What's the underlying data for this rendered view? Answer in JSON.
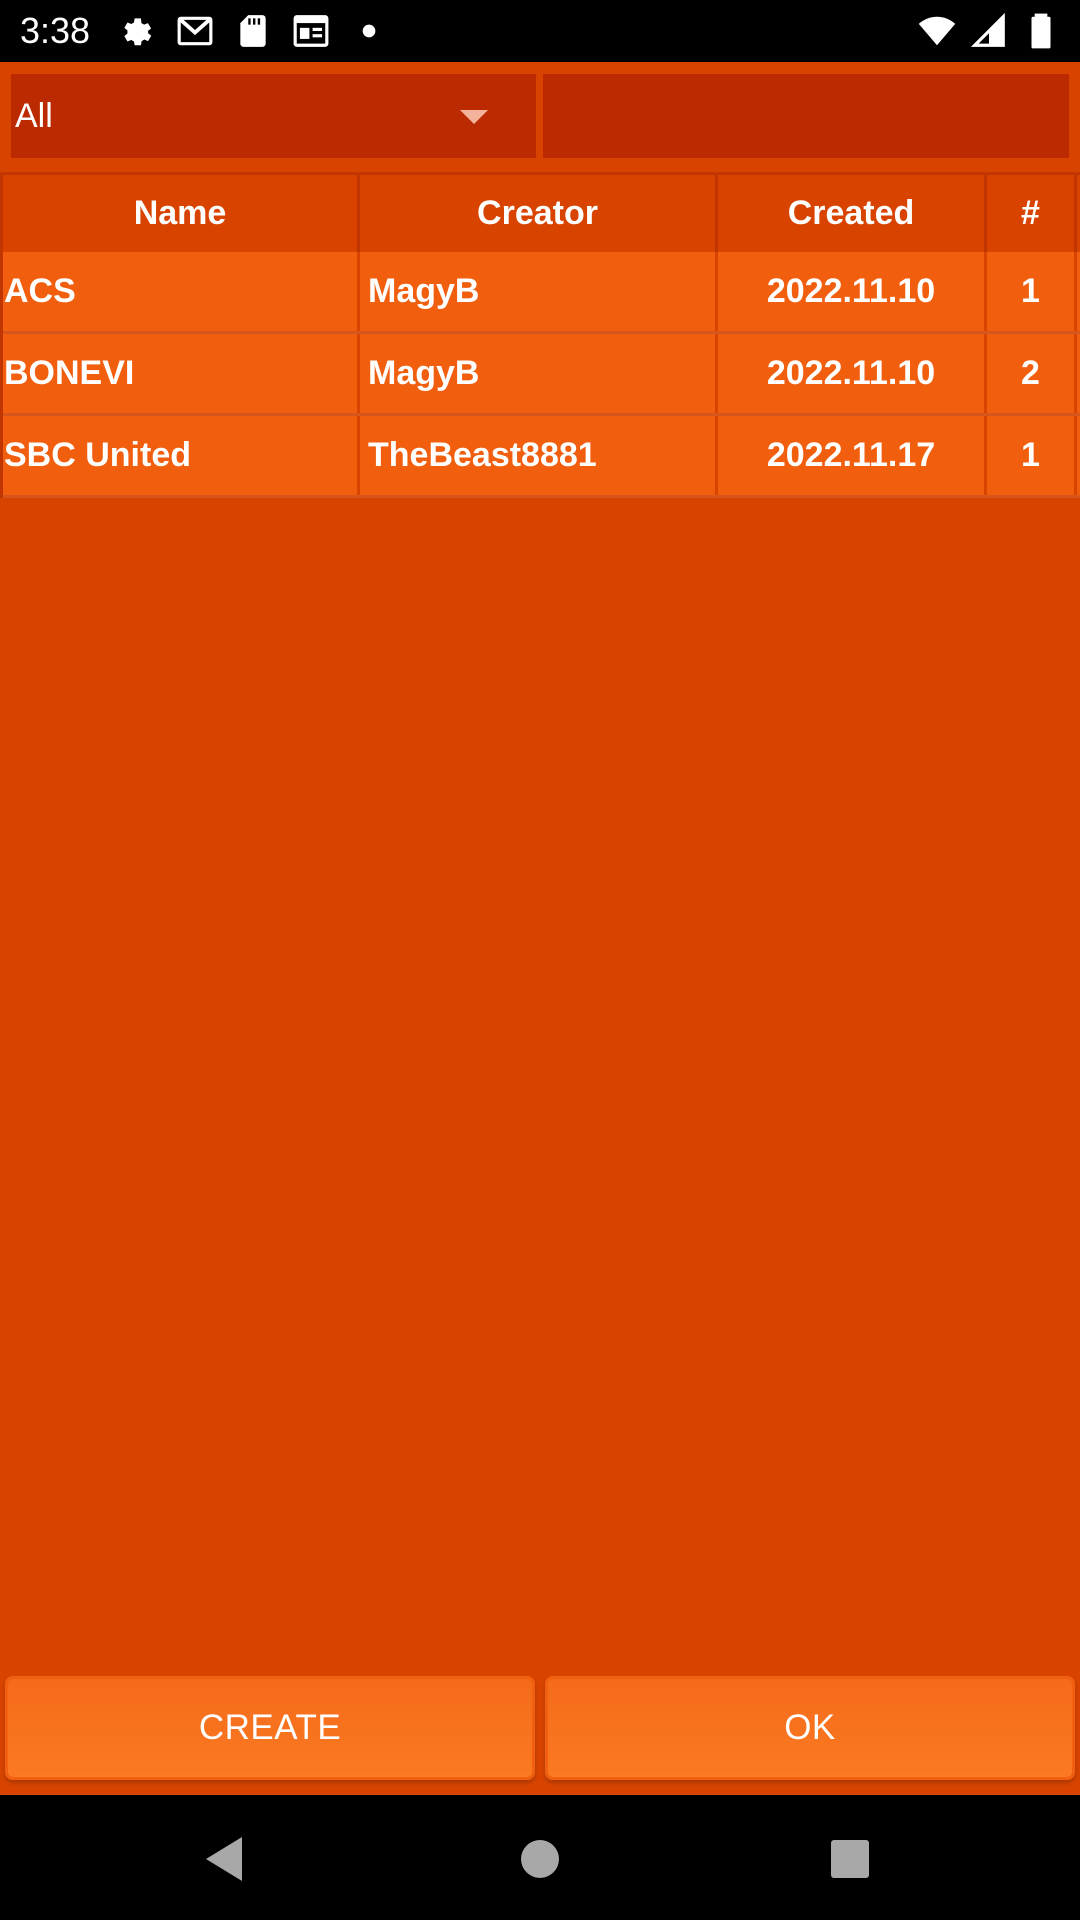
{
  "status_bar": {
    "time": "3:38",
    "left_icons": [
      "settings-icon",
      "gmail-icon",
      "sd-card-icon",
      "news-icon",
      "dot-icon"
    ],
    "right_icons": [
      "wifi-icon",
      "signal-icon",
      "battery-icon"
    ]
  },
  "filter": {
    "selected": "All",
    "search_value": ""
  },
  "table": {
    "headers": {
      "name": "Name",
      "creator": "Creator",
      "created": "Created",
      "count": "#"
    },
    "rows": [
      {
        "name": "ACS",
        "creator": "MagyB",
        "created": "2022.11.10",
        "count": "1"
      },
      {
        "name": "BONEVI",
        "creator": "MagyB",
        "created": "2022.11.10",
        "count": "2"
      },
      {
        "name": "SBC United",
        "creator": "TheBeast8881",
        "created": "2022.11.17",
        "count": "1"
      }
    ]
  },
  "buttons": {
    "create": "CREATE",
    "ok": "OK"
  },
  "colors": {
    "background": "#d84400",
    "row": "#f15e0e",
    "input": "#bb2a00",
    "button": "#f46a1a"
  }
}
